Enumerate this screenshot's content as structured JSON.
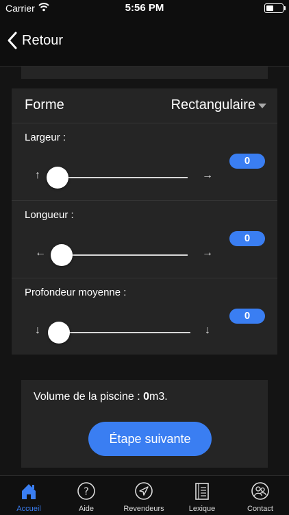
{
  "status": {
    "carrier": "Carrier",
    "time": "5:56 PM"
  },
  "nav": {
    "back_label": "Retour"
  },
  "forme": {
    "label": "Forme",
    "value": "Rectangulaire"
  },
  "sliders": [
    {
      "label": "Largeur :",
      "value": "0",
      "left_arrow": "↑",
      "right_arrow": "→",
      "level": 0
    },
    {
      "label": "Longueur :",
      "value": "0",
      "left_arrow": "←",
      "right_arrow": "→",
      "level": 0
    },
    {
      "label": "Profondeur moyenne :",
      "value": "0",
      "left_arrow": "↓",
      "right_arrow": "↓",
      "level": 0
    }
  ],
  "result": {
    "prefix": "Volume de la piscine : ",
    "value": "0",
    "unit": "m3."
  },
  "next_button": "Étape suivante",
  "tabs": [
    {
      "label": "Accueil",
      "icon": "home-icon",
      "active": true
    },
    {
      "label": "Aide",
      "icon": "help-icon",
      "active": false
    },
    {
      "label": "Revendeurs",
      "icon": "location-arrow-icon",
      "active": false
    },
    {
      "label": "Lexique",
      "icon": "book-icon",
      "active": false
    },
    {
      "label": "Contact",
      "icon": "contact-icon",
      "active": false
    }
  ],
  "colors": {
    "accent": "#3a7ef2",
    "card": "#252525",
    "background": "#141414"
  }
}
